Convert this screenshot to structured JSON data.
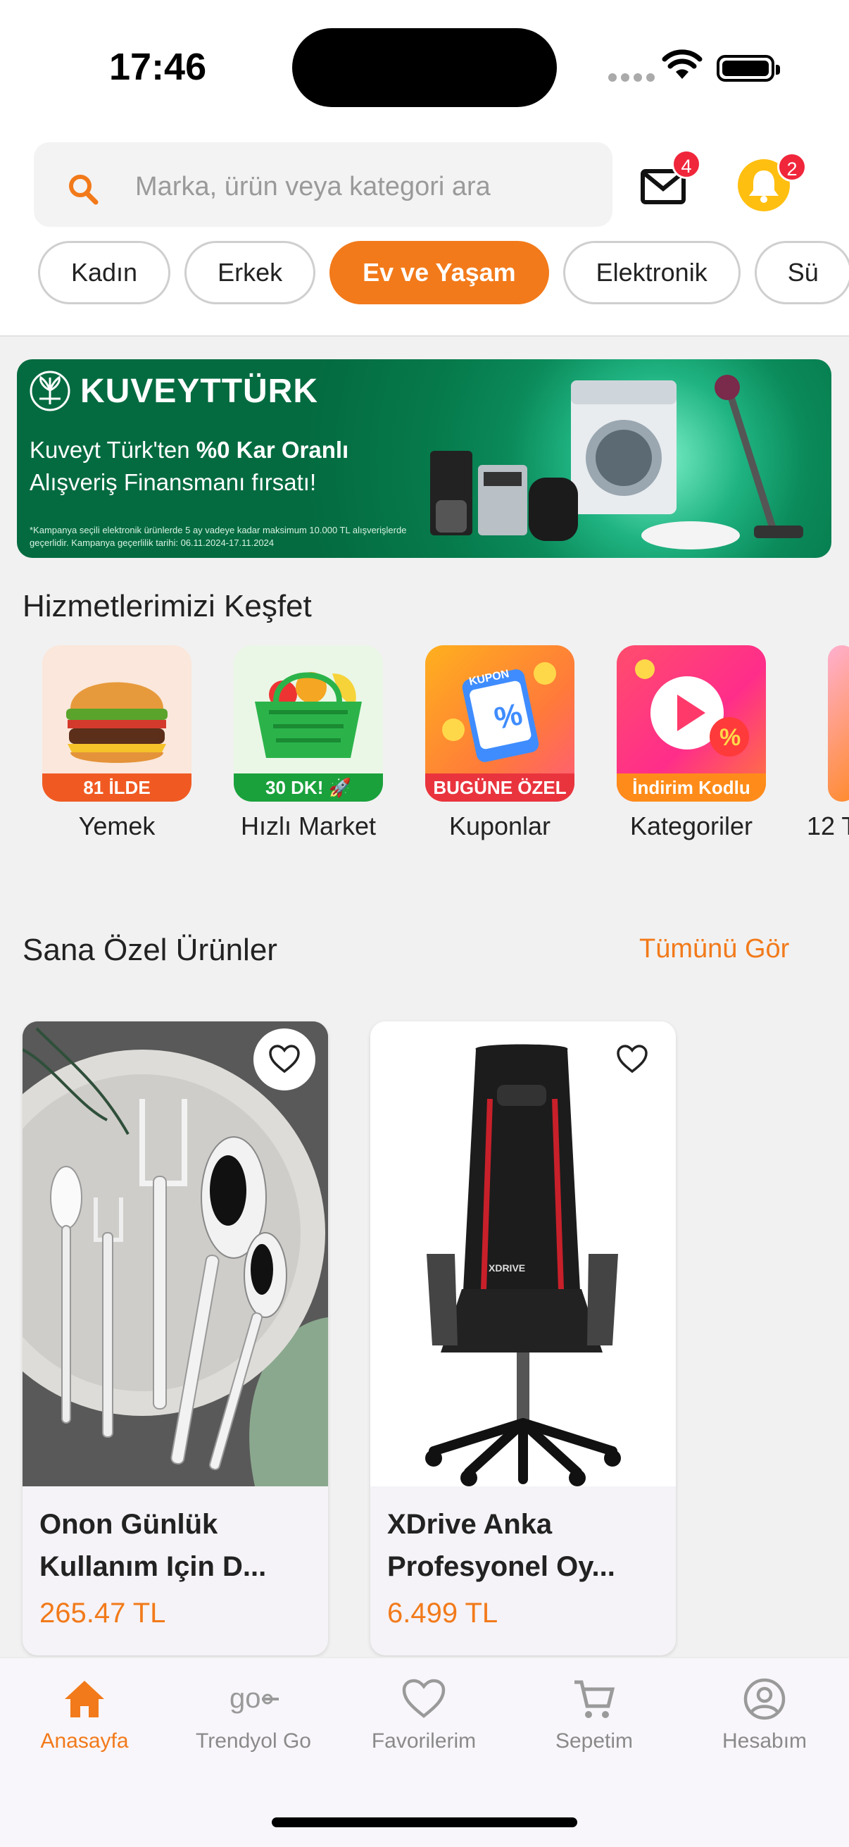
{
  "status_bar": {
    "time": "17:46"
  },
  "search": {
    "placeholder": "Marka, ürün veya kategori ara",
    "icon": "search-icon"
  },
  "header": {
    "mail_badge": "4",
    "bell_badge": "2",
    "accent": "#f27a1a"
  },
  "chips": [
    "Kadın",
    "Erkek",
    "Ev ve Yaşam",
    "Elektronik",
    "Sü"
  ],
  "active_chip": "Ev ve Yaşam",
  "banner": {
    "brand": "KUVEYTTÜRK",
    "line1_prefix": "Kuveyt Türk'ten ",
    "line1_bold": "%0 Kar Oranlı",
    "line2": "Alışveriş Finansmanı fırsatı!",
    "fine_print": "*Kampanya seçili elektronik ürünlerde 5 ay vadeye kadar maksimum 10.000 TL alışverişlerde geçerlidir. Kampanya geçerlilik tarihi: 06.11.2024-17.11.2024"
  },
  "services": {
    "title": "Hizmetlerimizi Keşfet",
    "items": [
      {
        "label": "Yemek",
        "ribbon": "81 İLDE"
      },
      {
        "label": "Hızlı Market",
        "ribbon": "30 DK! 🚀"
      },
      {
        "label": "Kuponlar",
        "ribbon": "BUGÜNE ÖZEL",
        "tag": "KUPON"
      },
      {
        "label": "Kategoriler",
        "ribbon": "İndirim Kodlu"
      },
      {
        "label": "12 T"
      }
    ]
  },
  "products": {
    "title": "Sana Özel Ürünler",
    "see_all": "Tümünü Gör",
    "items": [
      {
        "name": "Onon Günlük Kullanım Için D...",
        "price": "265.47 TL"
      },
      {
        "name": "XDrive Anka Profesyonel Oy...",
        "price": "6.499 TL",
        "chair_brand": "XDRIVE"
      }
    ]
  },
  "tabbar": [
    {
      "label": "Anasayfa",
      "icon": "home-icon",
      "active": true
    },
    {
      "label": "Trendyol Go",
      "icon": "go-icon",
      "active": false
    },
    {
      "label": "Favorilerim",
      "icon": "heart-icon",
      "active": false
    },
    {
      "label": "Sepetim",
      "icon": "cart-icon",
      "active": false
    },
    {
      "label": "Hesabım",
      "icon": "account-icon",
      "active": false
    }
  ]
}
